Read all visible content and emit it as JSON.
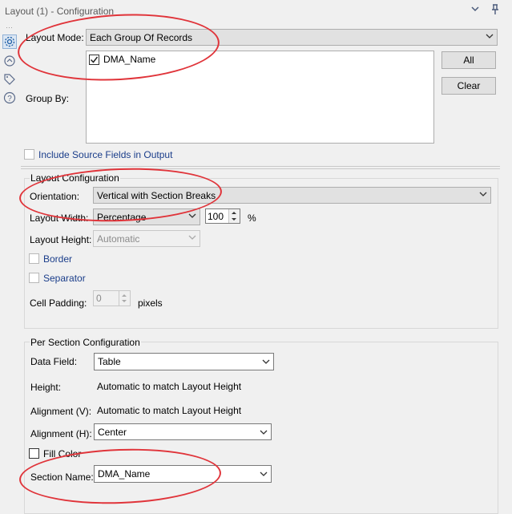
{
  "window": {
    "title": "Layout (1) - Configuration"
  },
  "icons": {
    "chevron": "chevron-down-icon",
    "pin": "pin-icon",
    "settings": "gear-icon",
    "connection": "connection-icon",
    "tag": "tag-icon",
    "help": "help-icon"
  },
  "top": {
    "layout_mode_label": "Layout Mode:",
    "layout_mode_value": "Each Group Of Records",
    "group_by_label": "Group By:",
    "group_by_items": [
      {
        "label": "DMA_Name",
        "checked": true
      }
    ],
    "all_button": "All",
    "clear_button": "Clear",
    "include_source_label": "Include Source Fields in Output"
  },
  "layout_config": {
    "section_title": "Layout Configuration",
    "orientation_label": "Orientation:",
    "orientation_value": "Vertical with Section Breaks",
    "layout_width_label": "Layout Width:",
    "layout_width_value": "Percentage",
    "layout_width_number": "100",
    "layout_width_unit": "%",
    "layout_height_label": "Layout Height:",
    "layout_height_value": "Automatic",
    "border_label": "Border",
    "separator_label": "Separator",
    "cell_padding_label": "Cell Padding:",
    "cell_padding_value": "0",
    "cell_padding_unit": "pixels"
  },
  "per_section": {
    "section_title": "Per Section Configuration",
    "data_field_label": "Data Field:",
    "data_field_value": "Table",
    "height_label": "Height:",
    "height_value": "Automatic to match Layout Height",
    "alignment_v_label": "Alignment (V):",
    "alignment_v_value": "Automatic to match Layout Height",
    "alignment_h_label": "Alignment (H):",
    "alignment_h_value": "Center",
    "fill_color_label": "Fill Color",
    "section_name_label": "Section Name:",
    "section_name_value": "DMA_Name"
  },
  "annotation_color": "#e0343a",
  "accent_color": "#1a3d8a"
}
